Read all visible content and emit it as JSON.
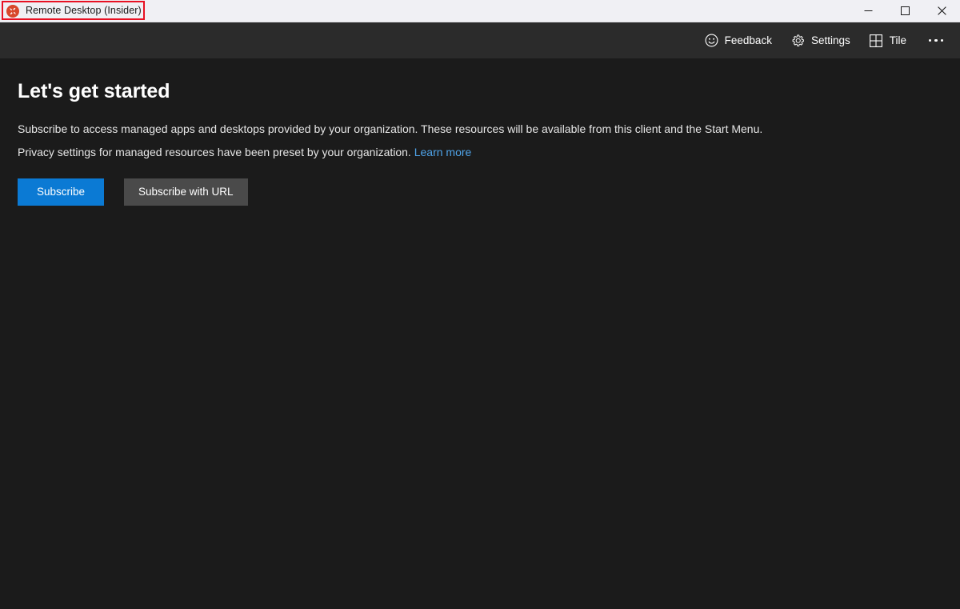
{
  "window": {
    "title": "Remote Desktop (Insider)",
    "app_icon": "remote-desktop-icon",
    "controls": {
      "minimize": "minimize-icon",
      "maximize": "maximize-icon",
      "close": "close-icon"
    }
  },
  "annotation": {
    "color": "#e81123",
    "target": "titlebar-app-title"
  },
  "toolbar": {
    "items": [
      {
        "label": "Feedback",
        "icon": "smiley-icon"
      },
      {
        "label": "Settings",
        "icon": "gear-icon"
      },
      {
        "label": "Tile",
        "icon": "grid-tile-icon"
      }
    ],
    "more_label": "more-options-ellipsis"
  },
  "main": {
    "title": "Let's get started",
    "paragraph_1": "Subscribe to access managed apps and desktops provided by your organization. These resources will be available from this client and the Start Menu.",
    "paragraph_2_prefix": "Privacy settings for managed resources have been preset by your organization. ",
    "learn_more_label": "Learn more",
    "buttons": {
      "primary": "Subscribe",
      "secondary": "Subscribe with URL"
    }
  },
  "colors": {
    "titlebar_bg": "#f0f0f4",
    "toolbar_bg": "#2b2b2b",
    "content_bg": "#1b1b1b",
    "accent_blue": "#0b7ad4",
    "link_blue": "#4fa3e8",
    "secondary_button": "#4a4a4a",
    "annotation_red": "#e81123",
    "app_icon_red": "#d8472b"
  }
}
